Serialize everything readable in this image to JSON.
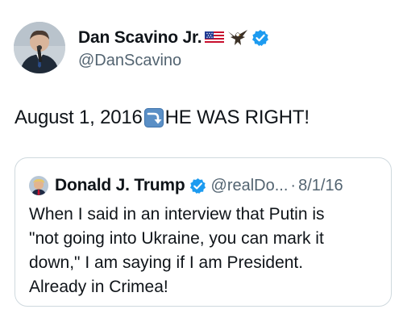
{
  "author": {
    "name": "Dan Scavino Jr.",
    "handle": "@DanScavino",
    "emoji_icons": [
      "us-flag-icon",
      "eagle-icon"
    ],
    "verified_color": "#1d9bf0"
  },
  "tweet": {
    "text_before": "August 1, 2016",
    "arrow_icon": "right-arrow-curving-down-icon",
    "text_after": "HE WAS RIGHT!"
  },
  "quote": {
    "name": "Donald J. Trump",
    "handle": "@realDo...",
    "dot": "·",
    "date": "8/1/16",
    "lines": [
      "When I said in an interview that Putin is",
      "\"not going into Ukraine, you can mark it",
      "down,\" I am saying if I am President.",
      "Already in Crimea!"
    ]
  }
}
